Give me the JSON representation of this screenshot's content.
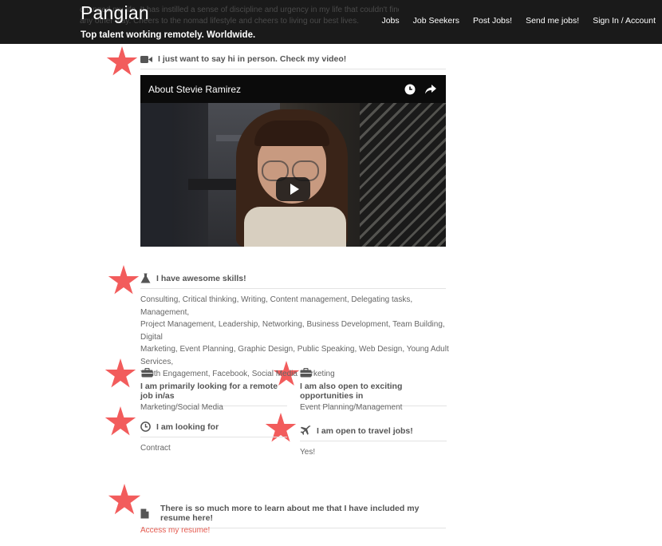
{
  "header": {
    "brand": "Pangian",
    "tagline": "Top talent working remotely. Worldwide.",
    "ghost_line1": "changed my life. It has instilled a sense of discipline and urgency in my life that couldn't find any",
    "ghost_line2": "any other way. Cheers to the nomad lifestyle and cheers to living our best lives.",
    "nav": [
      "Jobs",
      "Job Seekers",
      "Post Jobs!",
      "Send me jobs!",
      "Sign In / Account"
    ]
  },
  "video_section": {
    "heading": "I just want to say hi in person. Check my video!",
    "video_title": "About Stevie Ramirez",
    "icons": [
      "video-camera-icon",
      "clock-icon",
      "share-icon",
      "play-icon"
    ]
  },
  "skills_section": {
    "heading": "I have awesome skills!",
    "icon": "flask-icon",
    "skills_line1": "Consulting, Critical thinking, Writing, Content management, Delegating tasks, Management,",
    "skills_line2": "Project Management, Leadership, Networking, Business Development, Team Building, Digital",
    "skills_line3": "Marketing, Event Planning, Graphic Design, Public Speaking, Web Design, Young Adult Services,",
    "skills_line4": "Youth Engagement, Facebook, Social Media Marketing"
  },
  "primary_job": {
    "heading": "I am primarily looking for a remote job in/as",
    "value": "Marketing/Social Media",
    "icon": "briefcase-icon"
  },
  "open_to": {
    "heading": "I am also open to exciting opportunities in",
    "value": "Event Planning/Management",
    "icon": "briefcase-icon"
  },
  "looking_for": {
    "heading": "I am looking for",
    "value": "Contract",
    "icon": "clock-icon"
  },
  "travel": {
    "heading": "I am open to travel jobs!",
    "value": "Yes!",
    "icon": "plane-icon"
  },
  "resume": {
    "heading": "There is so much more to learn about me that I have included my resume here!",
    "link": "Access my resume!",
    "icon": "document-icon"
  },
  "colors": {
    "header_bg": "#1a1a1a",
    "star": "#f25c5c",
    "link": "#e55a4f",
    "text": "#555555"
  }
}
